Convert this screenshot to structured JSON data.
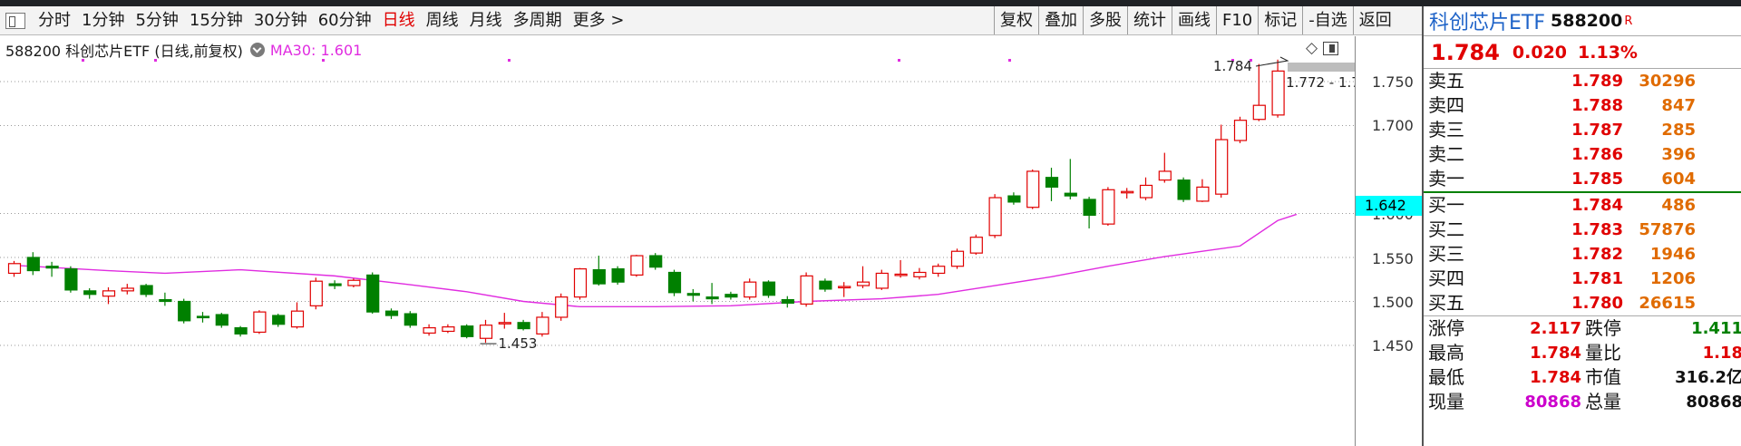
{
  "toolbar": {
    "left_items": [
      {
        "label": "分时",
        "active": false
      },
      {
        "label": "1分钟",
        "active": false
      },
      {
        "label": "5分钟",
        "active": false
      },
      {
        "label": "15分钟",
        "active": false
      },
      {
        "label": "30分钟",
        "active": false
      },
      {
        "label": "60分钟",
        "active": false
      },
      {
        "label": "日线",
        "active": true
      },
      {
        "label": "周线",
        "active": false
      },
      {
        "label": "月线",
        "active": false
      },
      {
        "label": "多周期",
        "active": false
      },
      {
        "label": "更多 >",
        "active": false
      }
    ],
    "right_buttons": [
      "复权",
      "叠加",
      "多股",
      "统计",
      "画线",
      "F10",
      "标记",
      "-自选",
      "返回"
    ]
  },
  "chart": {
    "legend_title": "588200 科创芯片ETF (日线,前复权)",
    "ma_label": "MA30: 1.601",
    "high_annotation": "1.784",
    "range_annotation": "1.772 - 1.7",
    "low_annotation": "1.453",
    "axis_labels": [
      "1.750",
      "1.700",
      "1.600",
      "1.550",
      "1.500",
      "1.450"
    ],
    "current_price_tag": "1.642",
    "colors": {
      "up": "#e00000",
      "down": "#008000",
      "ma": "#e02ce0",
      "price_tag": "#00ffff",
      "background": "#ffffff"
    }
  },
  "chart_data": {
    "type": "candlestick",
    "ylim": [
      1.43,
      1.79
    ],
    "grid": true,
    "candles": [
      {
        "o": 1.532,
        "c": 1.543,
        "h": 1.546,
        "l": 1.528
      },
      {
        "o": 1.55,
        "c": 1.535,
        "h": 1.556,
        "l": 1.53
      },
      {
        "o": 1.54,
        "c": 1.538,
        "h": 1.545,
        "l": 1.528
      },
      {
        "o": 1.537,
        "c": 1.513,
        "h": 1.54,
        "l": 1.51
      },
      {
        "o": 1.512,
        "c": 1.508,
        "h": 1.515,
        "l": 1.503
      },
      {
        "o": 1.506,
        "c": 1.512,
        "h": 1.516,
        "l": 1.497
      },
      {
        "o": 1.512,
        "c": 1.515,
        "h": 1.52,
        "l": 1.508
      },
      {
        "o": 1.518,
        "c": 1.508,
        "h": 1.52,
        "l": 1.505
      },
      {
        "o": 1.502,
        "c": 1.5,
        "h": 1.51,
        "l": 1.495
      },
      {
        "o": 1.5,
        "c": 1.478,
        "h": 1.503,
        "l": 1.475
      },
      {
        "o": 1.483,
        "c": 1.482,
        "h": 1.488,
        "l": 1.476
      },
      {
        "o": 1.485,
        "c": 1.473,
        "h": 1.487,
        "l": 1.47
      },
      {
        "o": 1.47,
        "c": 1.463,
        "h": 1.472,
        "l": 1.46
      },
      {
        "o": 1.465,
        "c": 1.488,
        "h": 1.49,
        "l": 1.463
      },
      {
        "o": 1.484,
        "c": 1.474,
        "h": 1.486,
        "l": 1.471
      },
      {
        "o": 1.471,
        "c": 1.489,
        "h": 1.499,
        "l": 1.469
      },
      {
        "o": 1.495,
        "c": 1.523,
        "h": 1.527,
        "l": 1.491
      },
      {
        "o": 1.52,
        "c": 1.518,
        "h": 1.524,
        "l": 1.514
      },
      {
        "o": 1.518,
        "c": 1.524,
        "h": 1.526,
        "l": 1.516
      },
      {
        "o": 1.53,
        "c": 1.488,
        "h": 1.533,
        "l": 1.486
      },
      {
        "o": 1.489,
        "c": 1.484,
        "h": 1.492,
        "l": 1.48
      },
      {
        "o": 1.486,
        "c": 1.473,
        "h": 1.489,
        "l": 1.47
      },
      {
        "o": 1.464,
        "c": 1.47,
        "h": 1.474,
        "l": 1.461
      },
      {
        "o": 1.466,
        "c": 1.471,
        "h": 1.474,
        "l": 1.464
      },
      {
        "o": 1.472,
        "c": 1.46,
        "h": 1.474,
        "l": 1.458
      },
      {
        "o": 1.458,
        "c": 1.473,
        "h": 1.479,
        "l": 1.453
      },
      {
        "o": 1.475,
        "c": 1.476,
        "h": 1.487,
        "l": 1.469
      },
      {
        "o": 1.476,
        "c": 1.469,
        "h": 1.479,
        "l": 1.467
      },
      {
        "o": 1.463,
        "c": 1.482,
        "h": 1.488,
        "l": 1.46
      },
      {
        "o": 1.482,
        "c": 1.505,
        "h": 1.509,
        "l": 1.478
      },
      {
        "o": 1.505,
        "c": 1.537,
        "h": 1.538,
        "l": 1.502
      },
      {
        "o": 1.536,
        "c": 1.52,
        "h": 1.552,
        "l": 1.518
      },
      {
        "o": 1.537,
        "c": 1.522,
        "h": 1.54,
        "l": 1.519
      },
      {
        "o": 1.53,
        "c": 1.552,
        "h": 1.553,
        "l": 1.528
      },
      {
        "o": 1.552,
        "c": 1.539,
        "h": 1.555,
        "l": 1.536
      },
      {
        "o": 1.533,
        "c": 1.51,
        "h": 1.536,
        "l": 1.506
      },
      {
        "o": 1.509,
        "c": 1.507,
        "h": 1.514,
        "l": 1.5
      },
      {
        "o": 1.505,
        "c": 1.503,
        "h": 1.521,
        "l": 1.497
      },
      {
        "o": 1.508,
        "c": 1.505,
        "h": 1.511,
        "l": 1.502
      },
      {
        "o": 1.505,
        "c": 1.522,
        "h": 1.526,
        "l": 1.502
      },
      {
        "o": 1.522,
        "c": 1.507,
        "h": 1.524,
        "l": 1.504
      },
      {
        "o": 1.502,
        "c": 1.498,
        "h": 1.506,
        "l": 1.493
      },
      {
        "o": 1.497,
        "c": 1.529,
        "h": 1.533,
        "l": 1.494
      },
      {
        "o": 1.523,
        "c": 1.514,
        "h": 1.526,
        "l": 1.511
      },
      {
        "o": 1.516,
        "c": 1.517,
        "h": 1.522,
        "l": 1.505
      },
      {
        "o": 1.518,
        "c": 1.522,
        "h": 1.54,
        "l": 1.515
      },
      {
        "o": 1.515,
        "c": 1.532,
        "h": 1.536,
        "l": 1.513
      },
      {
        "o": 1.53,
        "c": 1.531,
        "h": 1.547,
        "l": 1.527
      },
      {
        "o": 1.528,
        "c": 1.533,
        "h": 1.538,
        "l": 1.525
      },
      {
        "o": 1.532,
        "c": 1.54,
        "h": 1.543,
        "l": 1.528
      },
      {
        "o": 1.54,
        "c": 1.557,
        "h": 1.56,
        "l": 1.537
      },
      {
        "o": 1.555,
        "c": 1.573,
        "h": 1.576,
        "l": 1.553
      },
      {
        "o": 1.575,
        "c": 1.618,
        "h": 1.622,
        "l": 1.572
      },
      {
        "o": 1.62,
        "c": 1.613,
        "h": 1.624,
        "l": 1.61
      },
      {
        "o": 1.607,
        "c": 1.648,
        "h": 1.65,
        "l": 1.605
      },
      {
        "o": 1.641,
        "c": 1.63,
        "h": 1.652,
        "l": 1.614
      },
      {
        "o": 1.623,
        "c": 1.62,
        "h": 1.662,
        "l": 1.616
      },
      {
        "o": 1.616,
        "c": 1.598,
        "h": 1.619,
        "l": 1.583
      },
      {
        "o": 1.588,
        "c": 1.627,
        "h": 1.63,
        "l": 1.586
      },
      {
        "o": 1.624,
        "c": 1.625,
        "h": 1.629,
        "l": 1.617
      },
      {
        "o": 1.618,
        "c": 1.632,
        "h": 1.641,
        "l": 1.615
      },
      {
        "o": 1.638,
        "c": 1.648,
        "h": 1.669,
        "l": 1.635
      },
      {
        "o": 1.638,
        "c": 1.616,
        "h": 1.641,
        "l": 1.613
      },
      {
        "o": 1.614,
        "c": 1.63,
        "h": 1.639,
        "l": 1.613
      },
      {
        "o": 1.622,
        "c": 1.684,
        "h": 1.701,
        "l": 1.618
      },
      {
        "o": 1.683,
        "c": 1.706,
        "h": 1.71,
        "l": 1.68
      },
      {
        "o": 1.707,
        "c": 1.723,
        "h": 1.77,
        "l": 1.705
      },
      {
        "o": 1.712,
        "c": 1.762,
        "h": 1.775,
        "l": 1.709
      }
    ],
    "ma30": [
      [
        0,
        1.541
      ],
      [
        5,
        1.535
      ],
      [
        8,
        1.532
      ],
      [
        12,
        1.536
      ],
      [
        17,
        1.529
      ],
      [
        21,
        1.519
      ],
      [
        24,
        1.511
      ],
      [
        27,
        1.5
      ],
      [
        30,
        1.494
      ],
      [
        34,
        1.494
      ],
      [
        38,
        1.495
      ],
      [
        42,
        1.5
      ],
      [
        46,
        1.503
      ],
      [
        49,
        1.508
      ],
      [
        52,
        1.518
      ],
      [
        55,
        1.528
      ],
      [
        58,
        1.54
      ],
      [
        61,
        1.551
      ],
      [
        63,
        1.557
      ],
      [
        65,
        1.563
      ],
      [
        67,
        1.592
      ],
      [
        68,
        1.599
      ]
    ]
  },
  "quote": {
    "name": "科创芯片ETF",
    "code": "588200",
    "badge": "R",
    "last": "1.784",
    "change": "0.020",
    "pct": "1.13%",
    "asks": [
      {
        "label": "卖五",
        "price": "1.789",
        "vol": "30296"
      },
      {
        "label": "卖四",
        "price": "1.788",
        "vol": "847"
      },
      {
        "label": "卖三",
        "price": "1.787",
        "vol": "285"
      },
      {
        "label": "卖二",
        "price": "1.786",
        "vol": "396"
      },
      {
        "label": "卖一",
        "price": "1.785",
        "vol": "604"
      }
    ],
    "bids": [
      {
        "label": "买一",
        "price": "1.784",
        "vol": "486"
      },
      {
        "label": "买二",
        "price": "1.783",
        "vol": "57876"
      },
      {
        "label": "买三",
        "price": "1.782",
        "vol": "1946"
      },
      {
        "label": "买四",
        "price": "1.781",
        "vol": "1206"
      },
      {
        "label": "买五",
        "price": "1.780",
        "vol": "26615"
      }
    ],
    "stats": [
      {
        "label": "涨停",
        "value": "2.117",
        "value_color": "#e00000",
        "label2": "跌停",
        "value2": "1.411",
        "value2_color": "#008000"
      },
      {
        "label": "最高",
        "value": "1.784",
        "value_color": "#e00000",
        "label2": "量比",
        "value2": "1.18",
        "value2_color": "#e00000"
      },
      {
        "label": "最低",
        "value": "1.784",
        "value_color": "#e00000",
        "label2": "市值",
        "value2": "316.2亿",
        "value2_color": "#111111"
      },
      {
        "label": "现量",
        "value": "80868",
        "value_color": "#cc00cc",
        "label2": "总量",
        "value2": "80868",
        "value2_color": "#111111"
      }
    ]
  }
}
